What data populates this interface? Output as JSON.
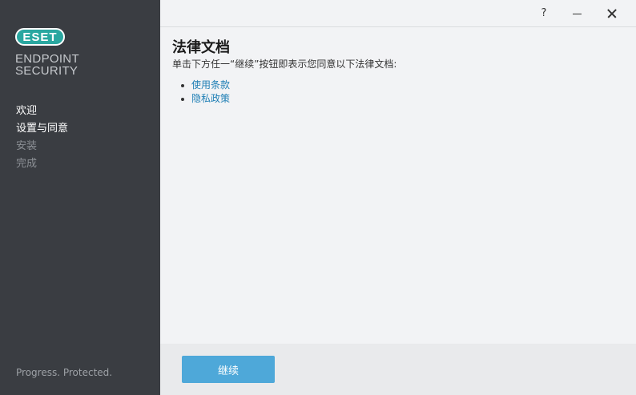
{
  "sidebar": {
    "logo_text": "ESET",
    "product_line1": "ENDPOINT",
    "product_line2": "SECURITY",
    "steps": [
      {
        "label": "欢迎",
        "state": "active"
      },
      {
        "label": "设置与同意",
        "state": "active"
      },
      {
        "label": "安装",
        "state": "inactive"
      },
      {
        "label": "完成",
        "state": "inactive"
      }
    ],
    "tagline": "Progress. Protected."
  },
  "titlebar": {
    "help": "?",
    "minimize_icon": "minimize-icon",
    "close_icon": "close-icon"
  },
  "main": {
    "title": "法律文档",
    "description": "单击下方任一“继续”按钮即表示您同意以下法律文档:",
    "documents": [
      {
        "label": "使用条款"
      },
      {
        "label": "隐私政策"
      }
    ]
  },
  "footer": {
    "continue_label": "继续"
  },
  "colors": {
    "sidebar_bg": "#3a3d42",
    "brand_teal": "#2aa7a0",
    "link": "#1f7fb5",
    "primary_button": "#4ea8d9"
  }
}
